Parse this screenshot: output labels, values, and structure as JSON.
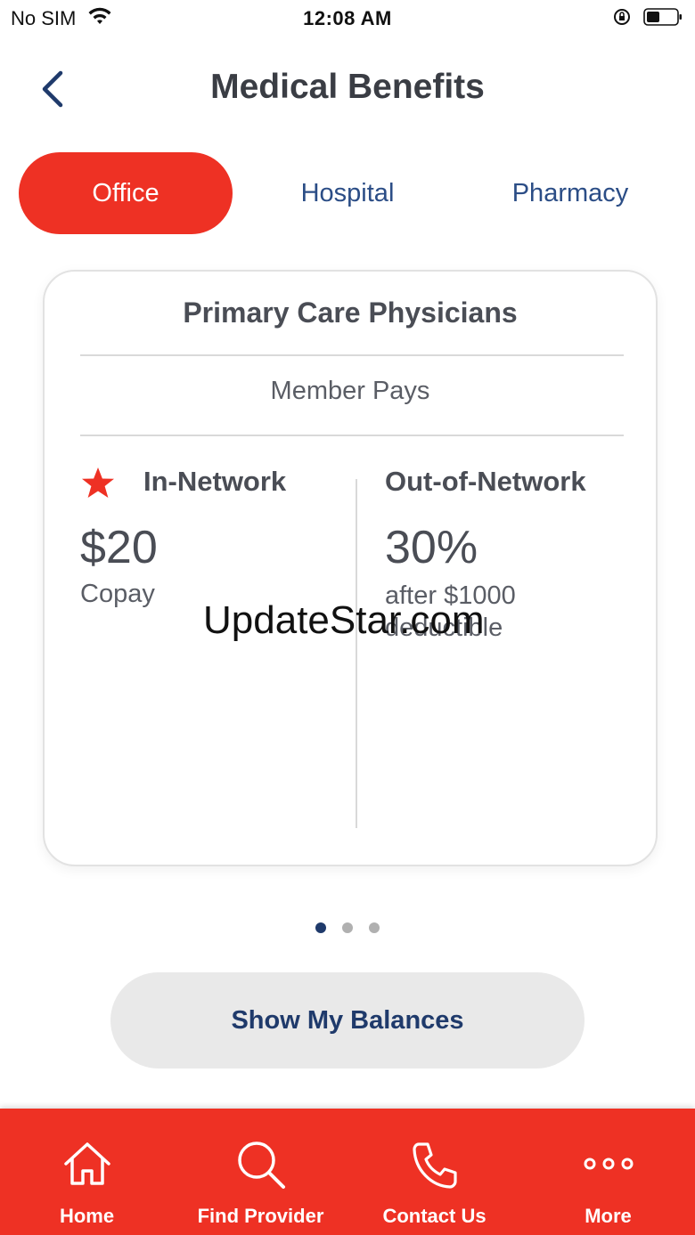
{
  "status_bar": {
    "carrier": "No SIM",
    "time": "12:08 AM",
    "icons": [
      "wifi-icon",
      "orientation-lock-icon",
      "battery-icon"
    ]
  },
  "header": {
    "title": "Medical Benefits",
    "back_icon": "chevron-left-icon"
  },
  "tabs": [
    {
      "label": "Office",
      "active": true
    },
    {
      "label": "Hospital",
      "active": false
    },
    {
      "label": "Pharmacy",
      "active": false
    }
  ],
  "card": {
    "title": "Primary Care Physicians",
    "subtitle": "Member Pays",
    "in_network": {
      "label": "In-Network",
      "amount": "$20",
      "note": "Copay",
      "icon": "star-icon"
    },
    "out_of_network": {
      "label": "Out-of-Network",
      "amount": "30%",
      "note": "after $1000 deductible"
    }
  },
  "watermark": "UpdateStar.com",
  "pager": {
    "count": 3,
    "active_index": 0
  },
  "balances_button": {
    "label": "Show My Balances"
  },
  "bottom_nav": [
    {
      "label": "Home",
      "icon": "home-icon"
    },
    {
      "label": "Find Provider",
      "icon": "search-icon"
    },
    {
      "label": "Contact Us",
      "icon": "phone-icon"
    },
    {
      "label": "More",
      "icon": "more-icon"
    }
  ],
  "colors": {
    "accent_red": "#ee3124",
    "navy": "#1f3a6b",
    "tab_blue": "#2b4d86"
  }
}
